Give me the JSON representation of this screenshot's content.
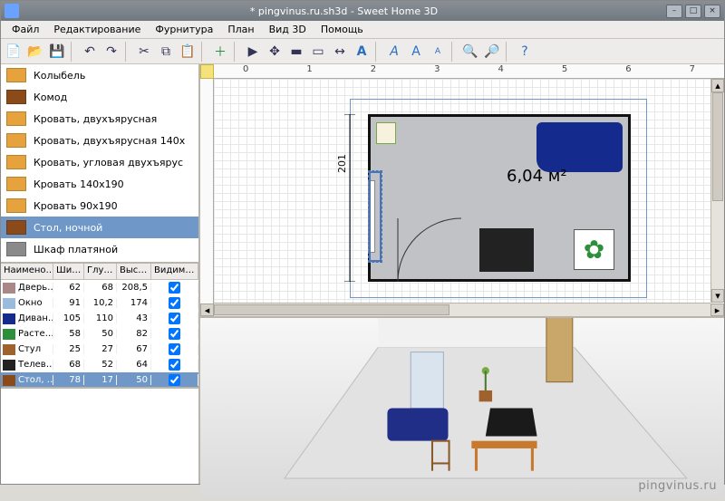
{
  "title": "* pingvinus.ru.sh3d - Sweet Home 3D",
  "menu": {
    "file": "Файл",
    "edit": "Редактирование",
    "furniture": "Фурнитура",
    "plan": "План",
    "view3d": "Вид 3D",
    "help": "Помощь"
  },
  "toolbar_icons": [
    "new",
    "open",
    "save",
    "sep",
    "undo",
    "redo",
    "sep",
    "cut",
    "copy",
    "paste",
    "sep",
    "add-furn",
    "sep",
    "pointer",
    "pan",
    "wall",
    "room",
    "dimension",
    "text",
    "sep",
    "text-bold",
    "text-italic",
    "text-bigger",
    "text-smaller",
    "sep",
    "zoom-in",
    "zoom-out",
    "sep",
    "help"
  ],
  "catalog": [
    {
      "icon": "#e6a23c",
      "label": "Колыбель"
    },
    {
      "icon": "#8b4a1a",
      "label": "Комод"
    },
    {
      "icon": "#e6a23c",
      "label": "Кровать, двухъярусная"
    },
    {
      "icon": "#e6a23c",
      "label": "Кровать, двухъярусная 140x"
    },
    {
      "icon": "#e6a23c",
      "label": "Кровать, угловая двухъярус"
    },
    {
      "icon": "#e6a23c",
      "label": "Кровать 140x190"
    },
    {
      "icon": "#e6a23c",
      "label": "Кровать 90x190"
    },
    {
      "icon": "#8b4a1a",
      "label": "Стол, ночной",
      "selected": true
    },
    {
      "icon": "#8a8a8a",
      "label": "Шкаф платяной"
    }
  ],
  "furniture_columns": {
    "name": "Наимено…",
    "w": "Ши…",
    "d": "Глу…",
    "h": "Выс…",
    "vis": "Видим…"
  },
  "furniture_rows": [
    {
      "icon": "#a88",
      "name": "Дверь…",
      "w": "62",
      "d": "68",
      "h": "208,5",
      "vis": true
    },
    {
      "icon": "#9bd",
      "name": "Окно",
      "w": "91",
      "d": "10,2",
      "h": "174",
      "vis": true
    },
    {
      "icon": "#142a8c",
      "name": "Диван…",
      "w": "105",
      "d": "110",
      "h": "43",
      "vis": true
    },
    {
      "icon": "#2c8f3a",
      "name": "Расте…",
      "w": "58",
      "d": "50",
      "h": "82",
      "vis": true
    },
    {
      "icon": "#a0622d",
      "name": "Стул",
      "w": "25",
      "d": "27",
      "h": "67",
      "vis": true
    },
    {
      "icon": "#222",
      "name": "Телев…",
      "w": "68",
      "d": "52",
      "h": "64",
      "vis": true
    },
    {
      "icon": "#8b4a1a",
      "name": "Стол, …",
      "w": "78",
      "d": "17",
      "h": "50",
      "vis": true,
      "selected": true
    }
  ],
  "ruler_ticks": [
    "0",
    "1",
    "2",
    "3",
    "4",
    "5",
    "6",
    "7"
  ],
  "room": {
    "area": "6,04 м²",
    "depth": "201"
  },
  "watermark": "pingvinus.ru"
}
